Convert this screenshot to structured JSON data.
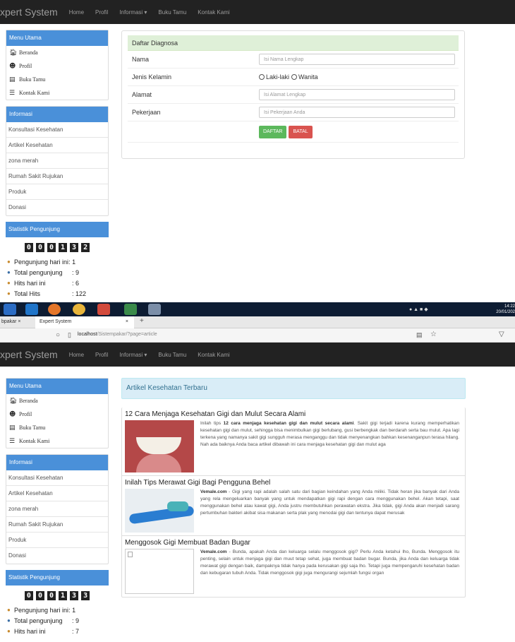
{
  "top": {
    "brand": "xpert System",
    "nav": [
      "Home",
      "Profil",
      "Informasi ▾",
      "Buku Tamu",
      "Kontak Kami"
    ],
    "sidebar": {
      "menu_title": "Menu Utama",
      "menu_items": [
        {
          "label": "Beranda",
          "icon": "home-icon"
        },
        {
          "label": "Profil",
          "icon": "user-icon"
        },
        {
          "label": "Buku  Tamu",
          "icon": "book-icon"
        },
        {
          "label": "Kontak  Kami",
          "icon": "contact-icon"
        }
      ],
      "info_title": "Informasi",
      "info_items": [
        "Konsultasi Kesehatan",
        "Artikel Kesehatan",
        "zona merah",
        "Rumah Sakit Rujukan",
        "Produk",
        "Donasi"
      ],
      "stat_title": "Statistik Pengunjung",
      "counter": [
        "0",
        "0",
        "0",
        "1",
        "3",
        "2"
      ],
      "stats": [
        {
          "label": "Pengunjung hari ini",
          "sep": ":",
          "value": "1"
        },
        {
          "label": "Total pengunjung",
          "sep": ":",
          "value": "9"
        },
        {
          "label": "Hits hari ini",
          "sep": ":",
          "value": "6"
        },
        {
          "label": "Total Hits",
          "sep": ":",
          "value": "122"
        }
      ]
    },
    "form": {
      "title": "Daftar Diagnosa",
      "nama_label": "Nama",
      "nama_placeholder": "Isi Nama Lengkap",
      "jk_label": "Jenis Kelamin",
      "jk_options": [
        "Laki-laki",
        "Wanita"
      ],
      "alamat_label": "Alamat",
      "alamat_placeholder": "Isi Alamat Lengkap",
      "pekerjaan_label": "Pekerjaan",
      "pekerjaan_placeholder": "Isi Pekerjaan Anda",
      "daftar_label": "DAFTAR",
      "batal_label": "BATAL"
    }
  },
  "taskbar": {
    "time": "14:22",
    "date": "20/01/202"
  },
  "browser": {
    "tab1": "bpakar",
    "tab1_close": "×",
    "tab2": "Expert System",
    "tab2_close": "×",
    "new_tab": "+",
    "url_host": "localhost",
    "url_path": "/Sistempakar/?page=article"
  },
  "bottom": {
    "brand": "xpert System",
    "nav": [
      "Home",
      "Profil",
      "Informasi ▾",
      "Buku Tamu",
      "Kontak Kami"
    ],
    "sidebar": {
      "menu_title": "Menu Utama",
      "menu_items": [
        {
          "label": "Beranda",
          "icon": "home-icon"
        },
        {
          "label": "Profil",
          "icon": "user-icon"
        },
        {
          "label": "Buku  Tamu",
          "icon": "book-icon"
        },
        {
          "label": "Kontak  Kami",
          "icon": "contact-icon"
        }
      ],
      "info_title": "Informasi",
      "info_items": [
        "Konsultasi Kesehatan",
        "Artikel Kesehatan",
        "zona merah",
        "Rumah Sakit Rujukan",
        "Produk",
        "Donasi"
      ],
      "stat_title": "Statistik Pengunjung",
      "counter": [
        "0",
        "0",
        "0",
        "1",
        "3",
        "3"
      ],
      "stats": [
        {
          "label": "Pengunjung hari ini",
          "sep": ":",
          "value": "1"
        },
        {
          "label": "Total pengunjung",
          "sep": ":",
          "value": "9"
        },
        {
          "label": "Hits hari ini",
          "sep": ":",
          "value": "7"
        }
      ]
    },
    "articles_header": "Artikel Kesehatan Terbaru",
    "articles": [
      {
        "title": "12 Cara Menjaga Kesehatan Gigi dan Mulut Secara Alami",
        "lead": "Inilah tips ",
        "bold": "12 cara menjaga kesehatan gigi dan mulut secara alami",
        "text": ". Sakit gigi terjadi karena kurang memperhatikan kesehatan gigi dan mulut, sehingga bisa menimbulkan gigi berlubang, gusi berbengkak dan berdarah serta bau mulut. Apa lagi terkena yang namanya sakit gigi sungguh merasa menganggu dan tidak menyenangkan bahkan kesenanganpun terasa hilang. Nah ada baiknya Anda baca artikel dibawah ini cara menjaga kesehatan gigi dan mulut aga"
      },
      {
        "title": "Inilah Tips Merawat Gigi Bagi Pengguna Behel",
        "lead": "",
        "bold": "Vemale.com",
        "text": " - Gigi yang rapi adalah salah satu dari bagian keindahan yang Anda miliki. Tidak heran jika banyak dari Anda yang rela mengeluarkan banyak yang untuk mendapatkan gigi rapi dengan cara menggunakan behel. Akan tetapi, saat menggunakan behel atau kawat gigi, Anda justru membutuhkan perawatan ekstra. Jika tidak, gigi Anda akan menjadi sarang pertumbuhan bakteri akibat sisa makanan serta plak yang menodai gigi dan tentunya dapat merusak"
      },
      {
        "title": "Menggosok Gigi Membuat Badan Bugar",
        "lead": "",
        "bold": "Vemale.com",
        "text": " - Bunda, apakah Anda dan keluarga selalu menggosok gigi? Perlu Anda ketahui lho, Bunda. Menggosok itu penting, selain untuk menjaga gigi dan muut tetap sehat, juga membuat badan bugar. Bunda, jika Anda dan keluarga tidak merawat gigi dengan baik, dampaknya tidak hanya pada kerusakan gigi saja lho. Tetapi juga mempengaruhi kesehatan badan dan kebugaran tubuh Anda. Tidak menggosok gigi juga mengurangi sejumlah fungsi organ"
      }
    ]
  }
}
